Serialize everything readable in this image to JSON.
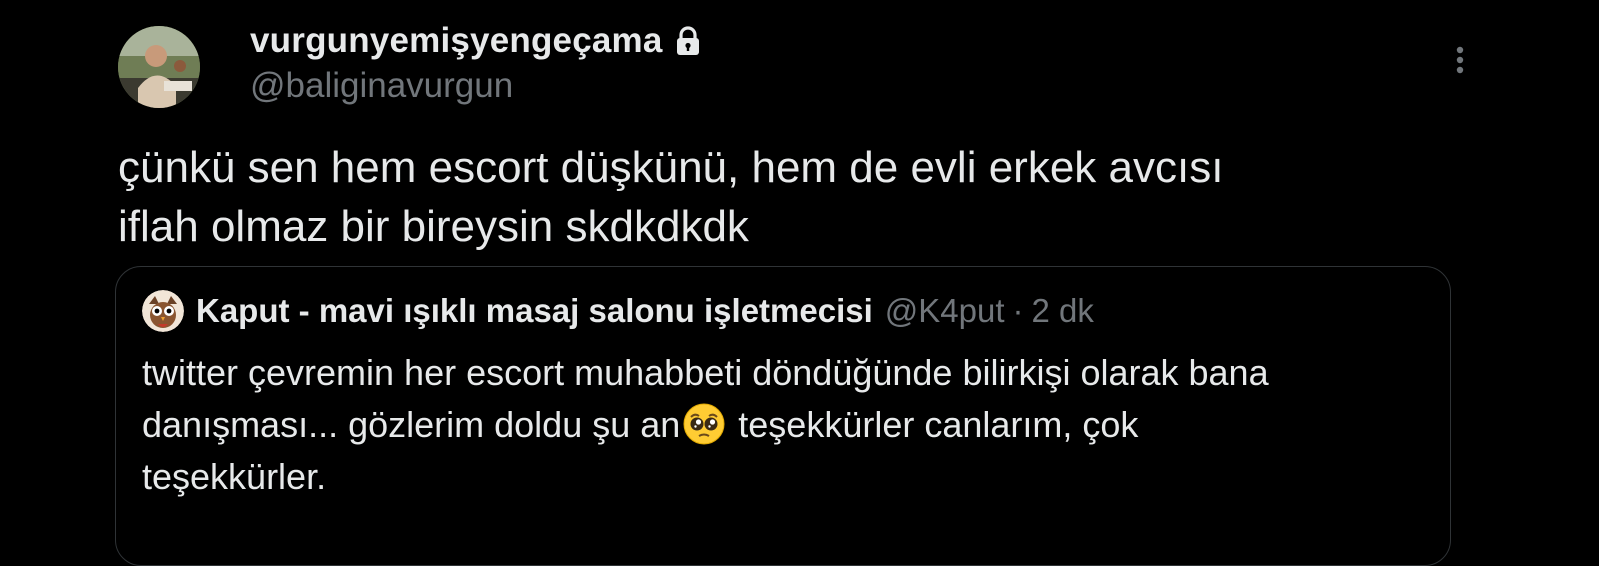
{
  "tweet": {
    "display_name": "vurgunyemişyengeçama",
    "handle": "@baliginavurgun",
    "icons": {
      "lock": "lock-icon",
      "more": "more-options-icon"
    },
    "text_lines": [
      "çünkü sen hem escort düşkünü, hem de evli erkek avcısı",
      "iflah olmaz bir bireysin skdkdkdk"
    ]
  },
  "quote": {
    "display_name": "Kaput - mavi ışıklı masaj salonu işletmecisi",
    "handle": "@K4put",
    "separator": "·",
    "time": "2 dk",
    "text_line1": "twitter çevremin her escort muhabbeti döndüğünde bilirkişi olarak bana",
    "text_line2_before": "danışması... gözlerim doldu şu an",
    "emoji": "pleading-face-emoji",
    "text_line2_after": " teşekkürler canlarım, çok",
    "text_line3": "teşekkürler."
  },
  "colors": {
    "background": "#000000",
    "primary_text": "#e7e9ea",
    "secondary_text": "#71767b",
    "border": "#2f3336"
  }
}
